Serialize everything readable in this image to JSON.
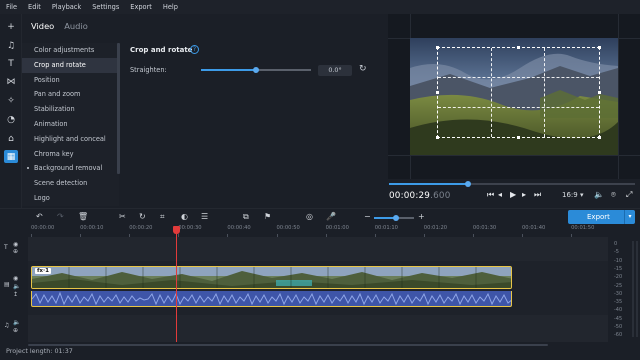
{
  "menu": [
    "File",
    "Edit",
    "Playback",
    "Settings",
    "Export",
    "Help"
  ],
  "tabs": [
    {
      "label": "Video",
      "active": true
    },
    {
      "label": "Audio",
      "active": false
    }
  ],
  "categories": [
    {
      "label": "Color adjustments",
      "active": false,
      "dot": false
    },
    {
      "label": "Crop and rotate",
      "active": true,
      "dot": false
    },
    {
      "label": "Position",
      "active": false,
      "dot": false
    },
    {
      "label": "Pan and zoom",
      "active": false,
      "dot": false
    },
    {
      "label": "Stabilization",
      "active": false,
      "dot": false
    },
    {
      "label": "Animation",
      "active": false,
      "dot": false
    },
    {
      "label": "Highlight and conceal",
      "active": false,
      "dot": false
    },
    {
      "label": "Chroma key",
      "active": false,
      "dot": false
    },
    {
      "label": "Background removal",
      "active": false,
      "dot": true
    },
    {
      "label": "Scene detection",
      "active": false,
      "dot": false
    },
    {
      "label": "Logo",
      "active": false,
      "dot": false
    }
  ],
  "panel": {
    "title": "Crop and rotate",
    "help_icon": "?",
    "straighten_label": "Straighten:",
    "straighten_value": "0.0°",
    "straighten_fraction": 0.5
  },
  "player": {
    "timecode": "00:00:29",
    "timecode_ms": ".600",
    "progress_fraction": 0.32,
    "aspect_ratio": "16:9 ▾"
  },
  "timeline": {
    "ruler": [
      "00:00:00",
      "00:00:10",
      "00:00:20",
      "00:00:30",
      "00:00:40",
      "00:00:50",
      "00:01:00",
      "00:01:10",
      "00:01:20",
      "00:01:30",
      "00:01:40",
      "00:01:50"
    ],
    "fx_badge": "fx·1",
    "zoom_fraction": 0.55,
    "export_label": "Export"
  },
  "meter": [
    "0",
    "-5",
    "-10",
    "-15",
    "-20",
    "-25",
    "-30",
    "-35",
    "-40",
    "-45",
    "-50",
    "-60"
  ],
  "status": {
    "project_length": "Project length: 01:37"
  },
  "colors": {
    "accent": "#2b8bd8",
    "playhead": "#e23b3b",
    "clip_border": "#e8c547",
    "audio": "#3e55a8"
  }
}
